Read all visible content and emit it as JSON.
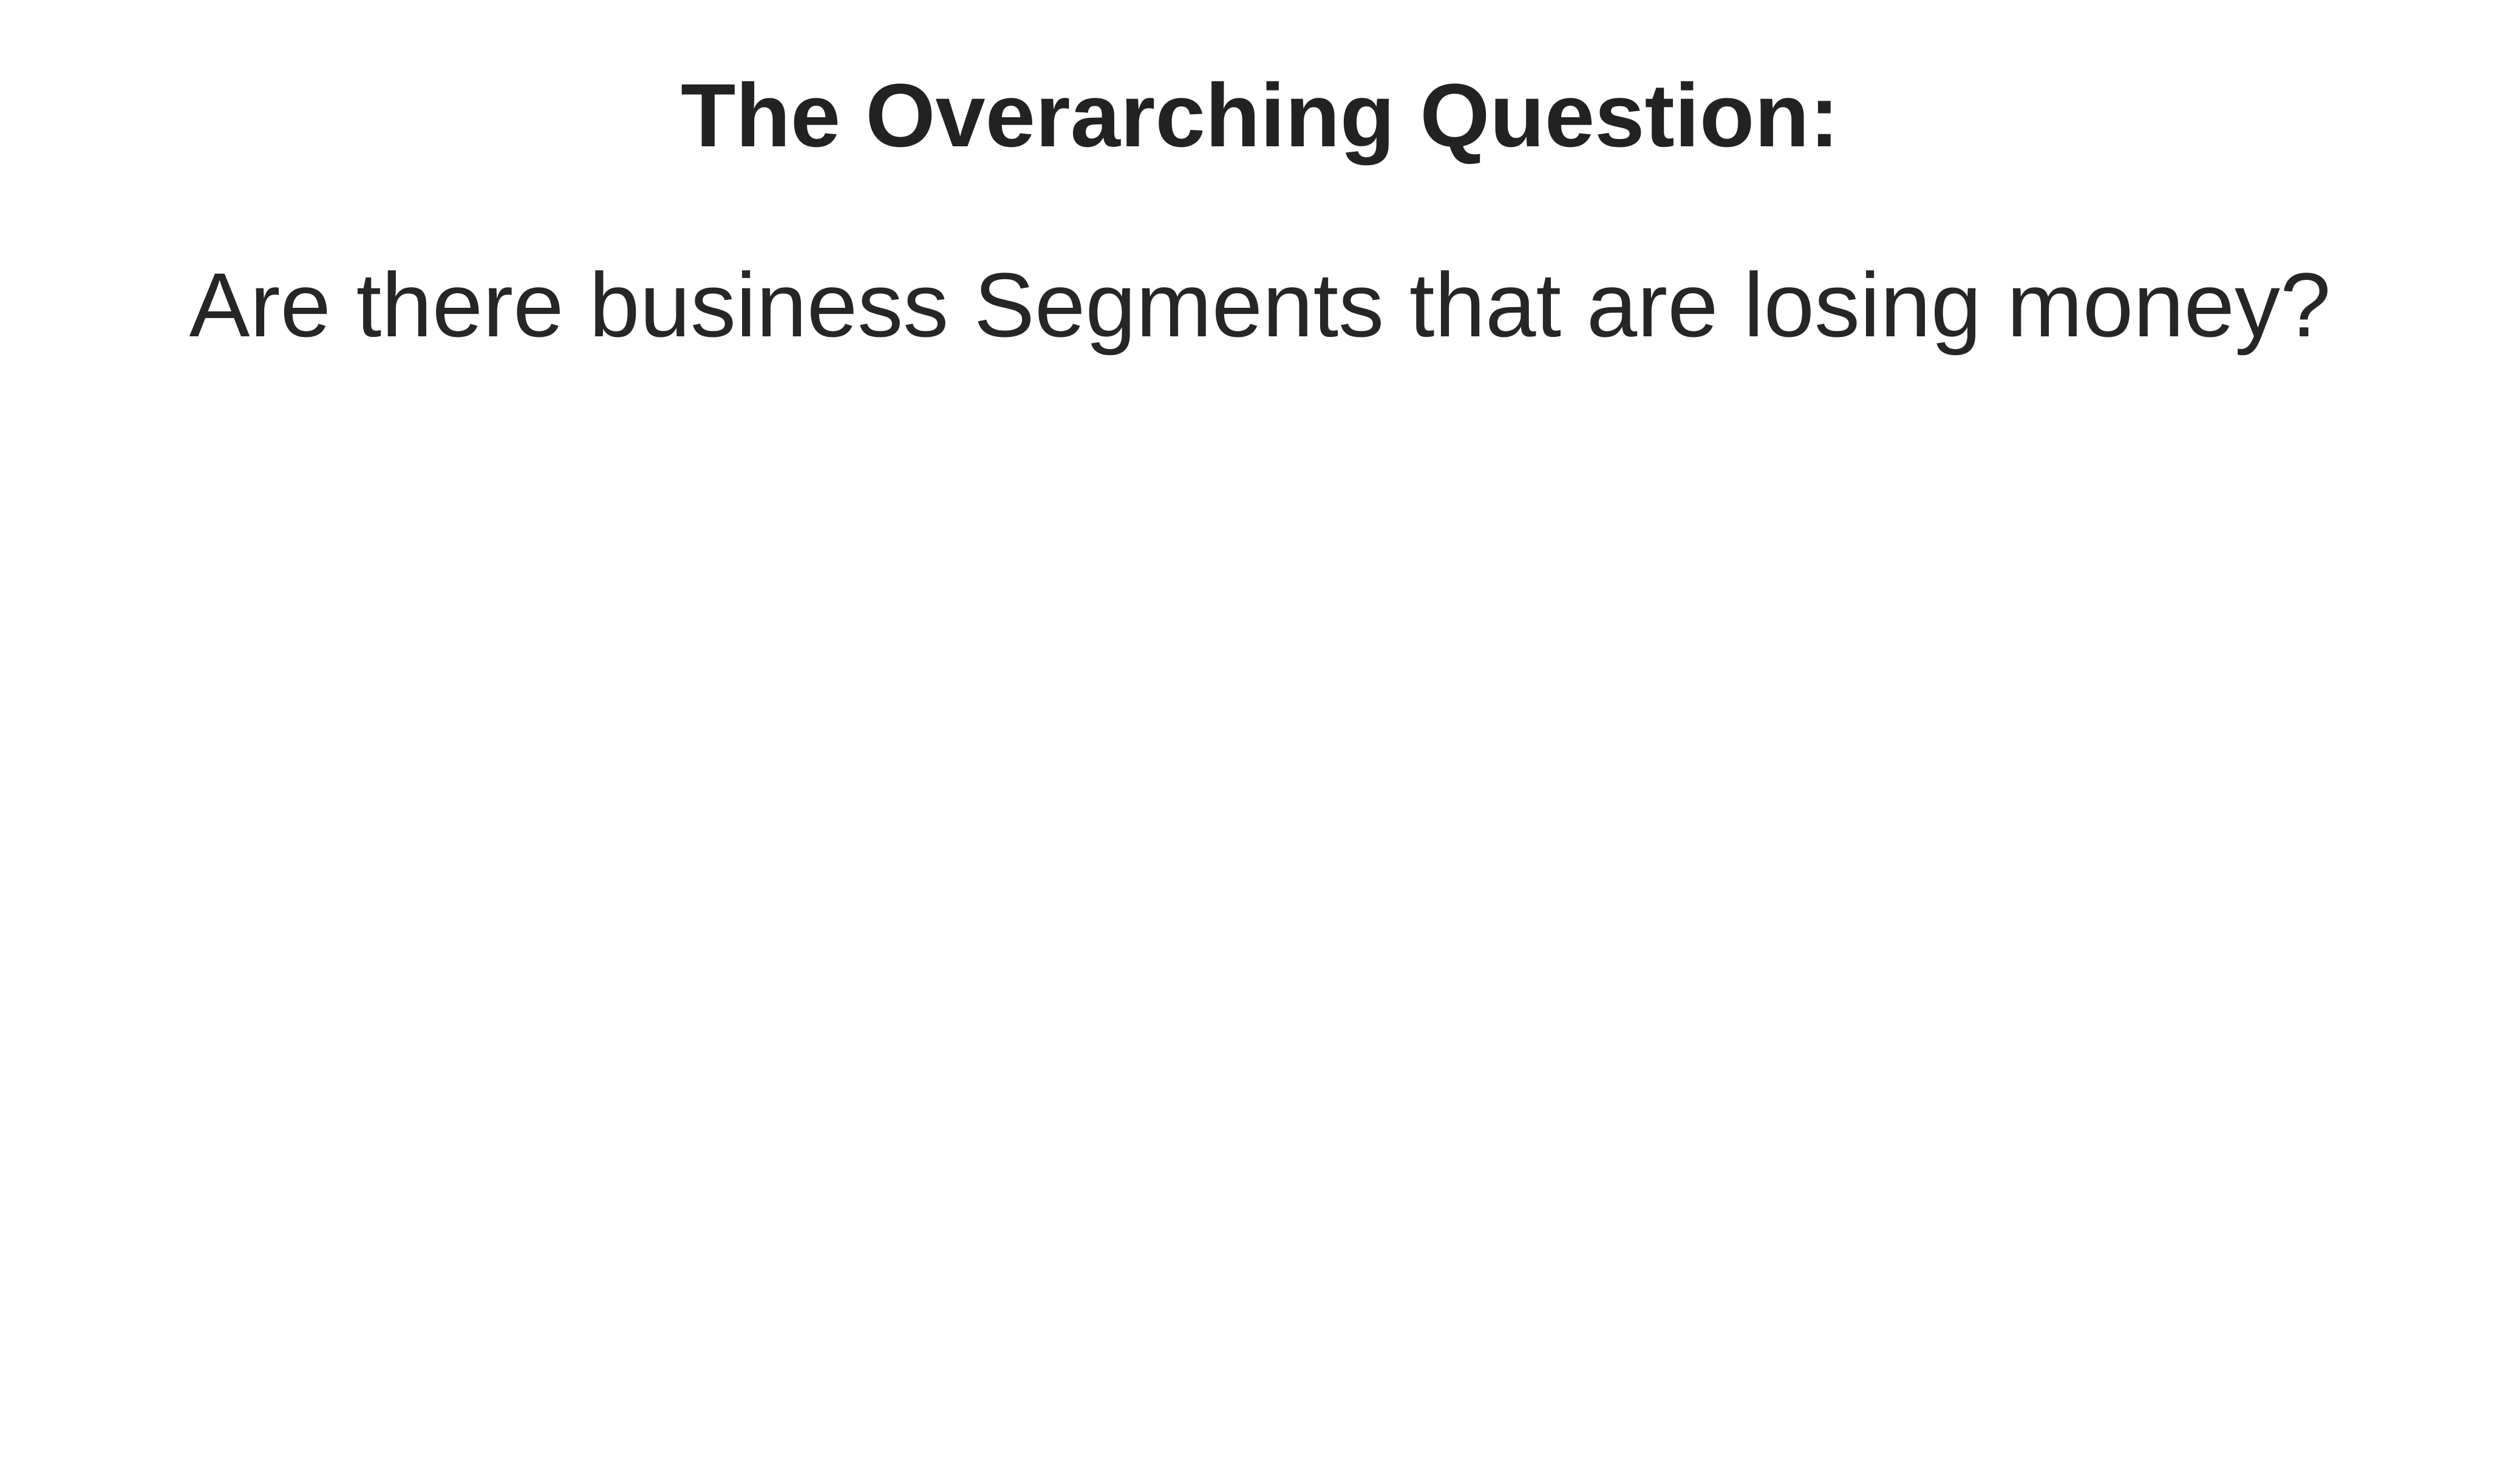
{
  "slide": {
    "title": "The Overarching Question:",
    "body": "Are there business Segments that are losing money?"
  },
  "colors": {
    "background": "#ffffff",
    "text": "#262626"
  }
}
